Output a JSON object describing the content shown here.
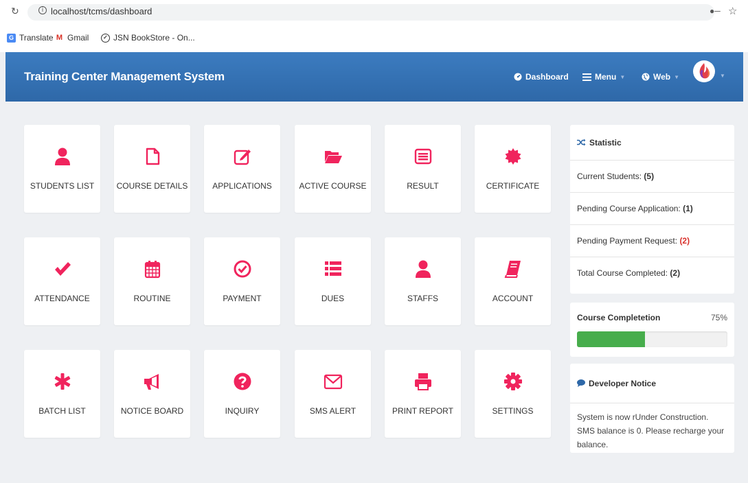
{
  "browser": {
    "url": "localhost/tcms/dashboard",
    "bookmarks": [
      {
        "label": "Translate",
        "icon": "google-translate-icon"
      },
      {
        "label": "Gmail",
        "icon": "gmail-icon"
      },
      {
        "label": "JSN BookStore - On...",
        "icon": "bookstore-icon"
      }
    ]
  },
  "navbar": {
    "brand": "Training Center Management System",
    "dashboard": "Dashboard",
    "menu": "Menu",
    "web": "Web"
  },
  "tiles": [
    {
      "label": "STUDENTS LIST",
      "icon": "user-icon"
    },
    {
      "label": "COURSE DETAILS",
      "icon": "file-icon"
    },
    {
      "label": "APPLICATIONS",
      "icon": "edit-icon"
    },
    {
      "label": "ACTIVE COURSE",
      "icon": "folder-open-icon"
    },
    {
      "label": "RESULT",
      "icon": "list-alt-icon"
    },
    {
      "label": "CERTIFICATE",
      "icon": "certificate-icon"
    },
    {
      "label": "ATTENDANCE",
      "icon": "check-icon"
    },
    {
      "label": "ROUTINE",
      "icon": "calendar-icon"
    },
    {
      "label": "PAYMENT",
      "icon": "check-circle-icon"
    },
    {
      "label": "DUES",
      "icon": "list-icon"
    },
    {
      "label": "STAFFS",
      "icon": "user-icon"
    },
    {
      "label": "ACCOUNT",
      "icon": "book-icon"
    },
    {
      "label": "BATCH LIST",
      "icon": "asterisk-icon"
    },
    {
      "label": "NOTICE BOARD",
      "icon": "bullhorn-icon"
    },
    {
      "label": "INQUIRY",
      "icon": "question-circle-icon"
    },
    {
      "label": "SMS ALERT",
      "icon": "envelope-icon"
    },
    {
      "label": "PRINT REPORT",
      "icon": "print-icon"
    },
    {
      "label": "SETTINGS",
      "icon": "cog-icon"
    }
  ],
  "statistic": {
    "title": "Statistic",
    "rows": [
      {
        "label": "Current Students:",
        "value": "(5)"
      },
      {
        "label": "Pending Course Application:",
        "value": "(1)"
      },
      {
        "label": "Pending Payment Request:",
        "value": "(2)"
      },
      {
        "label": "Total Course Completed:",
        "value": "(2)"
      }
    ]
  },
  "progress": {
    "title": "Course Completetion",
    "percent_label": "75%",
    "fraction": 0.45
  },
  "notice": {
    "title": "Developer Notice",
    "text": "System is now rUnder Construction. SMS balance is 0. Please recharge your balance."
  },
  "colors": {
    "accent": "#f0245d",
    "navbar": "#3572b5",
    "progress": "#47ad4c",
    "alert": "#d9302b"
  }
}
